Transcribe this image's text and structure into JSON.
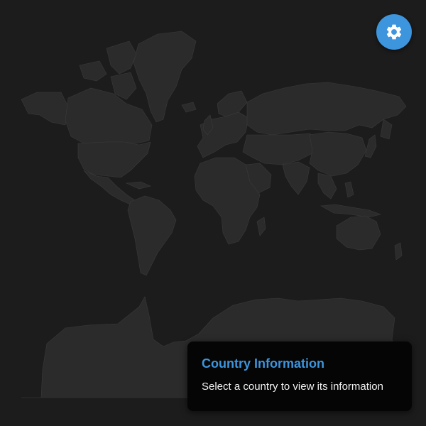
{
  "map": {
    "colors": {
      "background": "#1c1c1c",
      "land": "#2b2b2b",
      "border": "#3a3a3a"
    }
  },
  "settings": {
    "icon": "gear-icon",
    "color": "#3d95dd"
  },
  "info_panel": {
    "title": "Country Information",
    "message": "Select a country to view its information",
    "title_color": "#3d95dd",
    "background": "#050505"
  }
}
